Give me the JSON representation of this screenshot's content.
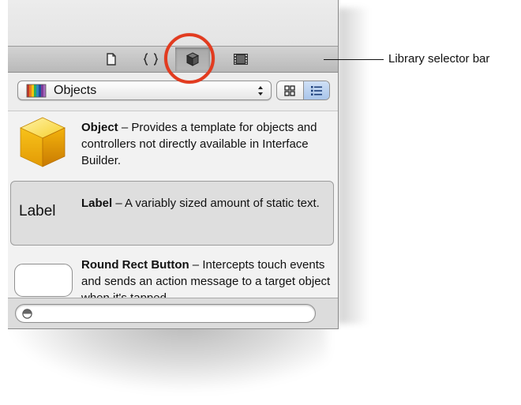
{
  "selector_bar": {
    "buttons": [
      {
        "name": "file-template-library",
        "icon": "file-icon"
      },
      {
        "name": "code-snippet-library",
        "icon": "braces-icon"
      },
      {
        "name": "object-library",
        "icon": "cube-icon",
        "selected": true
      },
      {
        "name": "media-library",
        "icon": "film-icon"
      }
    ]
  },
  "filter": {
    "popup_label": "Objects",
    "popup_icon": "books-icon",
    "view_modes": [
      {
        "name": "icon-view",
        "icon": "grid-icon",
        "selected": false
      },
      {
        "name": "list-view",
        "icon": "list-icon",
        "selected": true
      }
    ]
  },
  "library_items": [
    {
      "title": "Object",
      "description": " – Provides a template for objects and controllers not directly available in Interface Builder.",
      "icon": "yellow-cube-icon"
    },
    {
      "title": "Label",
      "description": " – A variably sized amount of static text.",
      "icon_text": "Label",
      "selected": true
    },
    {
      "title": "Round Rect Button",
      "description": " – Intercepts touch events and sends an action message to a target object when it's tapped.",
      "icon": "round-rect-button-icon"
    }
  ],
  "search": {
    "value": "",
    "placeholder": ""
  },
  "annotation": {
    "callout_label": "Library selector bar",
    "highlight_color": "#e23b1f"
  },
  "colors": {
    "selected_segment": "#a9c5ea",
    "panel_background": "#e9e9e9"
  }
}
